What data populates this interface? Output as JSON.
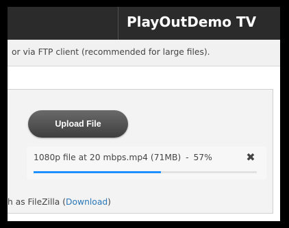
{
  "header": {
    "brand": "PlayOutDemo TV"
  },
  "notice": {
    "text": "or via FTP client (recommended for large files)."
  },
  "upload": {
    "button_label": "Upload File"
  },
  "file": {
    "name": "1080p file at 20 mbps.mp4",
    "size": "(71MB)",
    "separator": "-",
    "percent_label": "57%",
    "progress": 0.57
  },
  "footer": {
    "text_before": "h as FileZilla (",
    "link_text": "Download",
    "text_after": ")"
  },
  "colors": {
    "header_bg": "#2b2b2b",
    "progress": "#1e90ff",
    "link": "#2a77b8"
  },
  "icons": {
    "close": "close-icon"
  }
}
